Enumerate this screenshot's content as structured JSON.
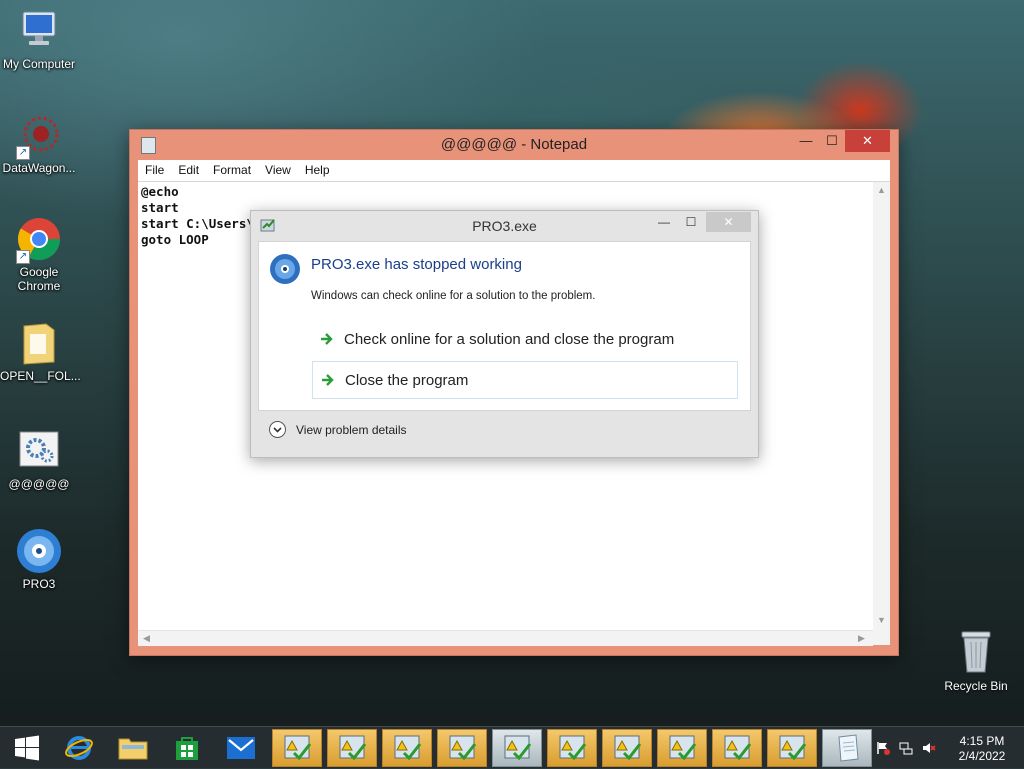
{
  "desktop": {
    "icons": [
      {
        "label": "My Computer"
      },
      {
        "label": "DataWagon..."
      },
      {
        "label": "Google Chrome"
      },
      {
        "label": "OPEN__FOL..."
      },
      {
        "label": "@@@@@"
      },
      {
        "label": "PRO3"
      }
    ],
    "recycle_bin": {
      "label": "Recycle Bin"
    }
  },
  "notepad": {
    "title": "@@@@@ - Notepad",
    "menu": [
      "File",
      "Edit",
      "Format",
      "View",
      "Help"
    ],
    "lines": [
      "@echo",
      "start",
      "start C:\\Users\\VM",
      "goto LOOP"
    ]
  },
  "dialog": {
    "title": "PRO3.exe",
    "heading": "PRO3.exe has stopped working",
    "subtext": "Windows can check online for a solution to the problem.",
    "option_check": "Check online for a solution and close the program",
    "option_close": "Close the program",
    "details": "View problem details"
  },
  "taskbar": {
    "clock_time": "4:15 PM",
    "clock_date": "2/4/2022"
  },
  "colors": {
    "notepad_frame": "#e9927a",
    "close_red": "#c7403a",
    "heading_blue": "#1a3f8a",
    "taskbar_active": "#f4c86b"
  }
}
